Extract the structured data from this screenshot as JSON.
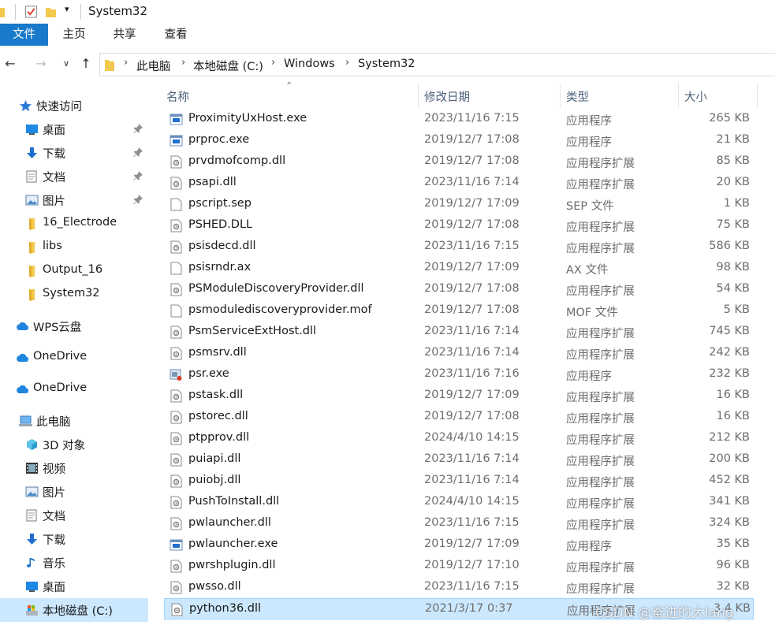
{
  "window": {
    "title": "System32"
  },
  "ribbon": {
    "tabs": [
      "文件",
      "主页",
      "共享",
      "查看"
    ]
  },
  "address": {
    "crumbs": [
      "此电脑",
      "本地磁盘 (C:)",
      "Windows",
      "System32"
    ]
  },
  "navpane": {
    "items": [
      {
        "label": "快速访问",
        "icon": "star-icon",
        "pinned": false
      },
      {
        "label": "桌面",
        "icon": "desktop-icon",
        "pinned": true
      },
      {
        "label": "下载",
        "icon": "download-icon",
        "pinned": true
      },
      {
        "label": "文档",
        "icon": "document-icon",
        "pinned": true
      },
      {
        "label": "图片",
        "icon": "picture-icon",
        "pinned": true
      },
      {
        "label": "16_Electrode",
        "icon": "folder-icon",
        "pinned": false
      },
      {
        "label": "libs",
        "icon": "folder-icon",
        "pinned": false
      },
      {
        "label": "Output_16",
        "icon": "folder-icon",
        "pinned": false
      },
      {
        "label": "System32",
        "icon": "folder-icon",
        "pinned": false
      },
      {
        "label": "WPS云盘",
        "icon": "cloud-icon",
        "pinned": false
      },
      {
        "label": "OneDrive",
        "icon": "cloud-icon",
        "pinned": false
      },
      {
        "label": "OneDrive",
        "icon": "cloud-icon",
        "pinned": false
      },
      {
        "label": "此电脑",
        "icon": "computer-icon",
        "pinned": false
      },
      {
        "label": "3D 对象",
        "icon": "cube-icon",
        "pinned": false
      },
      {
        "label": "视频",
        "icon": "video-icon",
        "pinned": false
      },
      {
        "label": "图片",
        "icon": "picture-icon",
        "pinned": false
      },
      {
        "label": "文档",
        "icon": "document-icon",
        "pinned": false
      },
      {
        "label": "下载",
        "icon": "download-icon",
        "pinned": false
      },
      {
        "label": "音乐",
        "icon": "music-icon",
        "pinned": false
      },
      {
        "label": "桌面",
        "icon": "desktop-icon",
        "pinned": false
      },
      {
        "label": "本地磁盘 (C:)",
        "icon": "drive-icon",
        "pinned": false
      }
    ]
  },
  "filelist": {
    "columns": {
      "name": "名称",
      "date": "修改日期",
      "type": "类型",
      "size": "大小"
    },
    "rows": [
      {
        "name": "ProximityUxHost.exe",
        "date": "2023/11/16 7:15",
        "type": "应用程序",
        "size": "265 KB",
        "icon": "exe-icon"
      },
      {
        "name": "prproc.exe",
        "date": "2019/12/7 17:08",
        "type": "应用程序",
        "size": "21 KB",
        "icon": "exe-icon"
      },
      {
        "name": "prvdmofcomp.dll",
        "date": "2019/12/7 17:08",
        "type": "应用程序扩展",
        "size": "85 KB",
        "icon": "dll-icon"
      },
      {
        "name": "psapi.dll",
        "date": "2023/11/16 7:14",
        "type": "应用程序扩展",
        "size": "20 KB",
        "icon": "dll-icon"
      },
      {
        "name": "pscript.sep",
        "date": "2019/12/7 17:09",
        "type": "SEP 文件",
        "size": "1 KB",
        "icon": "file-icon"
      },
      {
        "name": "PSHED.DLL",
        "date": "2019/12/7 17:08",
        "type": "应用程序扩展",
        "size": "75 KB",
        "icon": "dll-icon"
      },
      {
        "name": "psisdecd.dll",
        "date": "2023/11/16 7:15",
        "type": "应用程序扩展",
        "size": "586 KB",
        "icon": "dll-icon"
      },
      {
        "name": "psisrndr.ax",
        "date": "2019/12/7 17:09",
        "type": "AX 文件",
        "size": "98 KB",
        "icon": "file-icon"
      },
      {
        "name": "PSModuleDiscoveryProvider.dll",
        "date": "2019/12/7 17:08",
        "type": "应用程序扩展",
        "size": "54 KB",
        "icon": "dll-icon"
      },
      {
        "name": "psmodulediscoveryprovider.mof",
        "date": "2019/12/7 17:08",
        "type": "MOF 文件",
        "size": "5 KB",
        "icon": "file-icon"
      },
      {
        "name": "PsmServiceExtHost.dll",
        "date": "2023/11/16 7:14",
        "type": "应用程序扩展",
        "size": "745 KB",
        "icon": "dll-icon"
      },
      {
        "name": "psmsrv.dll",
        "date": "2023/11/16 7:14",
        "type": "应用程序扩展",
        "size": "242 KB",
        "icon": "dll-icon"
      },
      {
        "name": "psr.exe",
        "date": "2023/11/16 7:16",
        "type": "应用程序",
        "size": "232 KB",
        "icon": "psr-exe-icon"
      },
      {
        "name": "pstask.dll",
        "date": "2019/12/7 17:09",
        "type": "应用程序扩展",
        "size": "16 KB",
        "icon": "dll-icon"
      },
      {
        "name": "pstorec.dll",
        "date": "2019/12/7 17:08",
        "type": "应用程序扩展",
        "size": "16 KB",
        "icon": "dll-icon"
      },
      {
        "name": "ptpprov.dll",
        "date": "2024/4/10 14:15",
        "type": "应用程序扩展",
        "size": "212 KB",
        "icon": "dll-icon"
      },
      {
        "name": "puiapi.dll",
        "date": "2023/11/16 7:14",
        "type": "应用程序扩展",
        "size": "200 KB",
        "icon": "dll-icon"
      },
      {
        "name": "puiobj.dll",
        "date": "2023/11/16 7:14",
        "type": "应用程序扩展",
        "size": "452 KB",
        "icon": "dll-icon"
      },
      {
        "name": "PushToInstall.dll",
        "date": "2024/4/10 14:15",
        "type": "应用程序扩展",
        "size": "341 KB",
        "icon": "dll-icon"
      },
      {
        "name": "pwlauncher.dll",
        "date": "2023/11/16 7:15",
        "type": "应用程序扩展",
        "size": "324 KB",
        "icon": "dll-icon"
      },
      {
        "name": "pwlauncher.exe",
        "date": "2019/12/7 17:09",
        "type": "应用程序",
        "size": "35 KB",
        "icon": "exe-icon"
      },
      {
        "name": "pwrshplugin.dll",
        "date": "2019/12/7 17:10",
        "type": "应用程序扩展",
        "size": "96 KB",
        "icon": "dll-icon"
      },
      {
        "name": "pwsso.dll",
        "date": "2023/11/16 7:15",
        "type": "应用程序扩展",
        "size": "32 KB",
        "icon": "dll-icon"
      },
      {
        "name": "python36.dll",
        "date": "2021/3/17 0:37",
        "type": "应用程序扩展",
        "size": "3,4 KB",
        "icon": "dll-icon",
        "selected": true
      }
    ]
  },
  "watermark": "CSDN @奋进的大lang",
  "colors": {
    "accent": "#1979ca",
    "selection": "#cce8ff",
    "header_text": "#4c607a",
    "meta_text": "#6d6d6d",
    "folder": "#f2c94c"
  }
}
